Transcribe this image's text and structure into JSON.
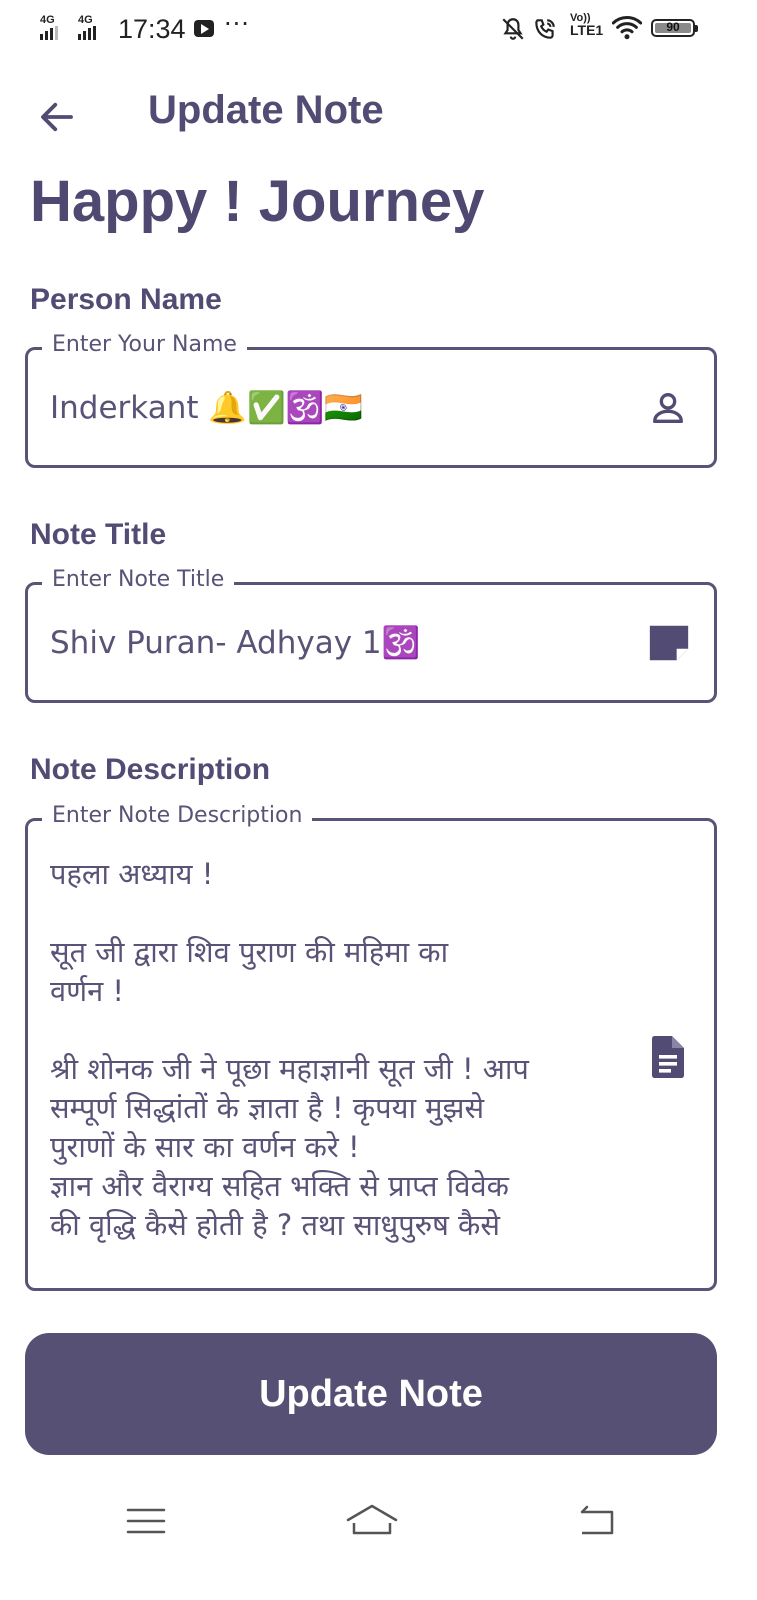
{
  "status_bar": {
    "network_1": "4G",
    "network_2": "4G",
    "time": "17:34",
    "overflow": "···",
    "volte_line1": "Vo))",
    "volte_line2": "LTE1",
    "battery": "90",
    "icons": [
      "youtube-icon",
      "mute-bell-icon",
      "wifi-calling-icon",
      "wifi-icon",
      "battery-icon"
    ]
  },
  "header": {
    "title": "Update Note"
  },
  "hero_title": "Happy ! Journey",
  "form": {
    "person_name": {
      "label": "Person Name",
      "legend": "Enter Your Name",
      "value": "Inderkant 🔔✅🕉️🇮🇳",
      "icon": "person-icon"
    },
    "note_title": {
      "label": "Note Title",
      "legend": "Enter Note Title",
      "value": "Shiv Puran- Adhyay 1🕉️",
      "icon": "note-icon"
    },
    "note_description": {
      "label": "Note Description",
      "legend": "Enter Note Description",
      "value": "पहला अध्याय !\n\nसूत जी द्वारा शिव पुराण की महिमा का\nवर्णन !\n\nश्री शोनक जी ने पूछा महाज्ञानी सूत जी ! आप\nसम्पूर्ण सिद्धांतों के ज्ञाता है ! कृपया मुझसे\nपुराणों के सार का वर्णन करे !\nज्ञान और वैराग्य सहित भक्ति से प्राप्त विवेक\nकी वृद्धि कैसे होती है ? तथा साधुपुरुष कैसे",
      "icon": "document-icon"
    }
  },
  "submit_label": "Update Note",
  "nav_bar": {
    "icons": [
      "menu-icon",
      "home-icon",
      "back-nav-icon"
    ]
  },
  "colors": {
    "primary": "#575075",
    "text": "#524b73",
    "border": "#5a5277",
    "background": "#ffffff"
  }
}
